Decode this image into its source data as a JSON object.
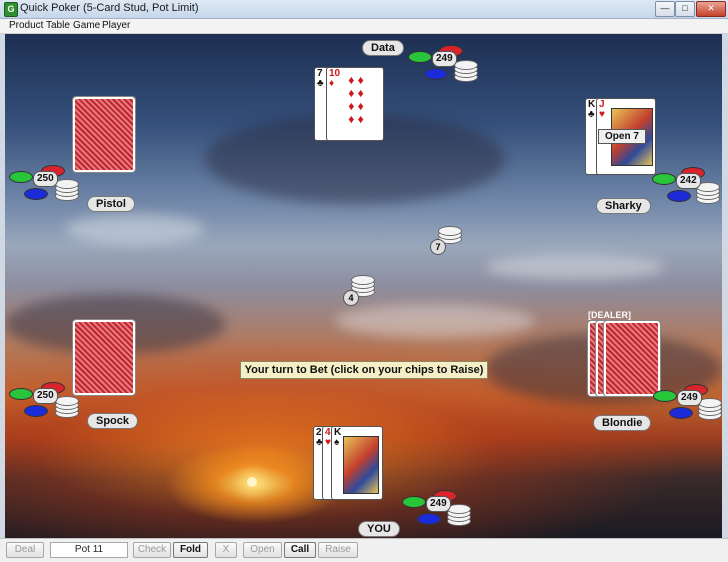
{
  "window": {
    "title": "Quick Poker (5-Card Stud, Pot Limit)",
    "app_icon": "G",
    "controls": [
      "minimize-icon",
      "maximize-icon",
      "close-icon"
    ]
  },
  "menu": [
    "Product",
    "Table",
    "Game",
    "Player"
  ],
  "players": {
    "data": {
      "name": "Data",
      "chips": "249"
    },
    "pistol": {
      "name": "Pistol",
      "chips": "250"
    },
    "sharky": {
      "name": "Sharky",
      "chips": "242",
      "hand_note": "Open 7"
    },
    "spock": {
      "name": "Spock",
      "chips": "250"
    },
    "blondie": {
      "name": "Blondie",
      "chips": "249",
      "dealer_tag": "[DEALER]"
    },
    "you": {
      "name": "YOU",
      "chips": "249"
    }
  },
  "cards": {
    "data": [
      {
        "rank": "7",
        "suit": "♣",
        "color": "black"
      },
      {
        "rank": "10",
        "suit": "♦",
        "color": "red"
      }
    ],
    "sharky": [
      {
        "rank": "K",
        "suit": "♣",
        "color": "black"
      },
      {
        "rank": "J",
        "suit": "♥",
        "color": "red"
      }
    ],
    "you": [
      {
        "rank": "2",
        "suit": "♣",
        "color": "black"
      },
      {
        "rank": "4",
        "suit": "♥",
        "color": "red"
      },
      {
        "rank": "K",
        "suit": "♠",
        "color": "black"
      }
    ]
  },
  "bets": {
    "sharky_bet": "7",
    "center_bet": "4"
  },
  "prompt": "Your turn to Bet (click on your chips to Raise)",
  "toolbar": {
    "deal": "Deal",
    "pot": "Pot 11",
    "check": "Check",
    "fold": "Fold",
    "x": "X",
    "open": "Open",
    "call": "Call",
    "raise": "Raise"
  },
  "colors": {
    "chip_green": "#28c43a",
    "chip_red": "#d8242a",
    "chip_blue": "#1c2bd8",
    "card_back": "#c0262d",
    "prompt_bg": "#f4efc6"
  }
}
